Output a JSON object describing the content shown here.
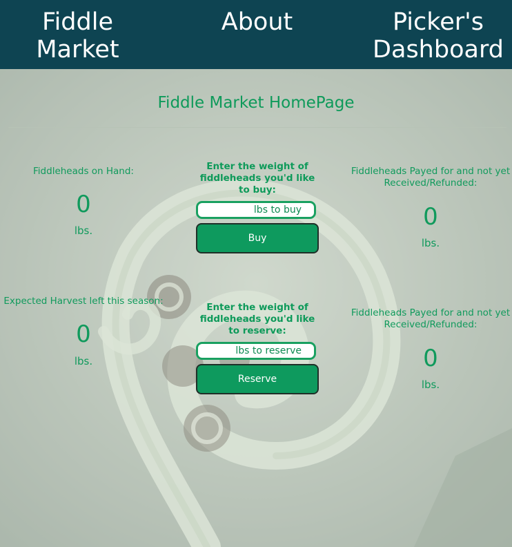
{
  "nav": {
    "home_label": "Fiddle Market",
    "about_label": "About",
    "dashboard_label": "Picker's Dashboard"
  },
  "page": {
    "title": "Fiddle Market HomePage"
  },
  "on_hand": {
    "label": "Fiddleheads on Hand:",
    "value": "0",
    "unit": "lbs."
  },
  "expected_harvest": {
    "label": "Expected Harvest left this season:",
    "value": "0",
    "unit": "lbs."
  },
  "buy": {
    "prompt": "Enter the weight of fiddleheads you'd like to buy:",
    "placeholder": "lbs to buy",
    "button_label": "Buy"
  },
  "reserve": {
    "prompt": "Enter the weight of fiddleheads you'd like to reserve:",
    "placeholder": "lbs to reserve",
    "button_label": "Reserve"
  },
  "pending_1": {
    "label": "Fiddleheads Payed for and not yet Received/Refunded:",
    "value": "0",
    "unit": "lbs."
  },
  "pending_2": {
    "label": "Fiddleheads Payed for and not yet Received/Refunded:",
    "value": "0",
    "unit": "lbs."
  },
  "colors": {
    "nav_bg": "#0e4452",
    "accent_green": "#0e9a5a",
    "button_bg": "#0e9a5e"
  }
}
